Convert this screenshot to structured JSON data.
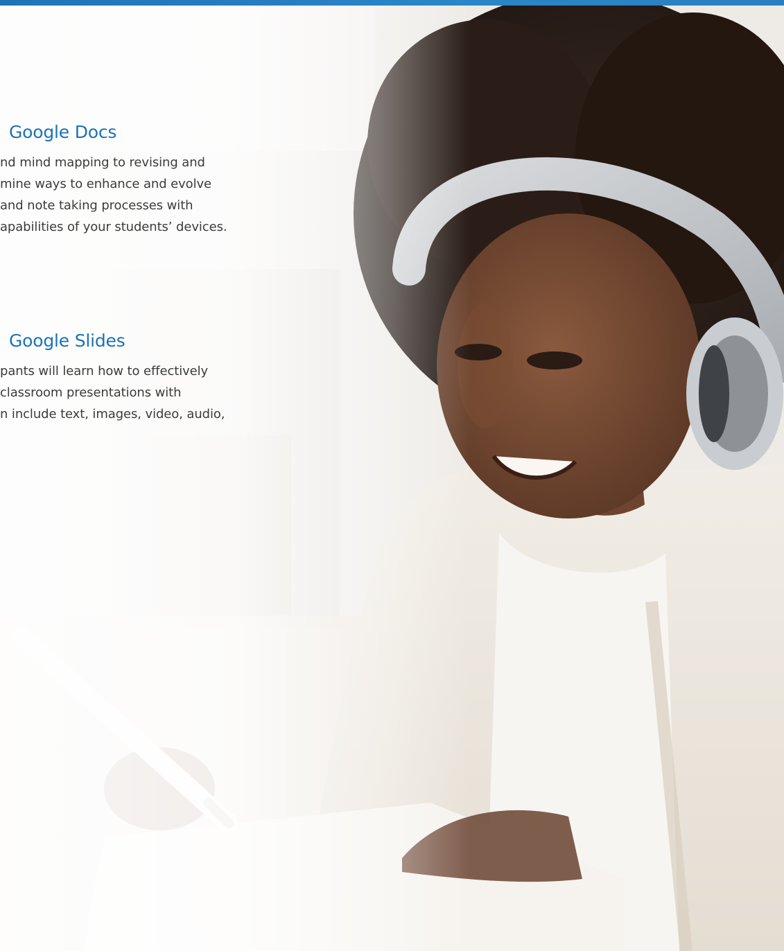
{
  "sections": [
    {
      "heading": "Google Docs",
      "lines": [
        "nd mind mapping to revising and",
        "mine ways to enhance and evolve",
        "and note taking processes with",
        "apabilities of your students’ devices."
      ]
    },
    {
      "heading": "Google Slides",
      "lines": [
        "pants will learn how to effectively",
        "classroom presentations with",
        "n include text, images, video, audio,"
      ]
    }
  ],
  "colors": {
    "accent": "#1a73b5",
    "top_bar": "#2b86c8",
    "body_text": "#3b3b3b"
  }
}
